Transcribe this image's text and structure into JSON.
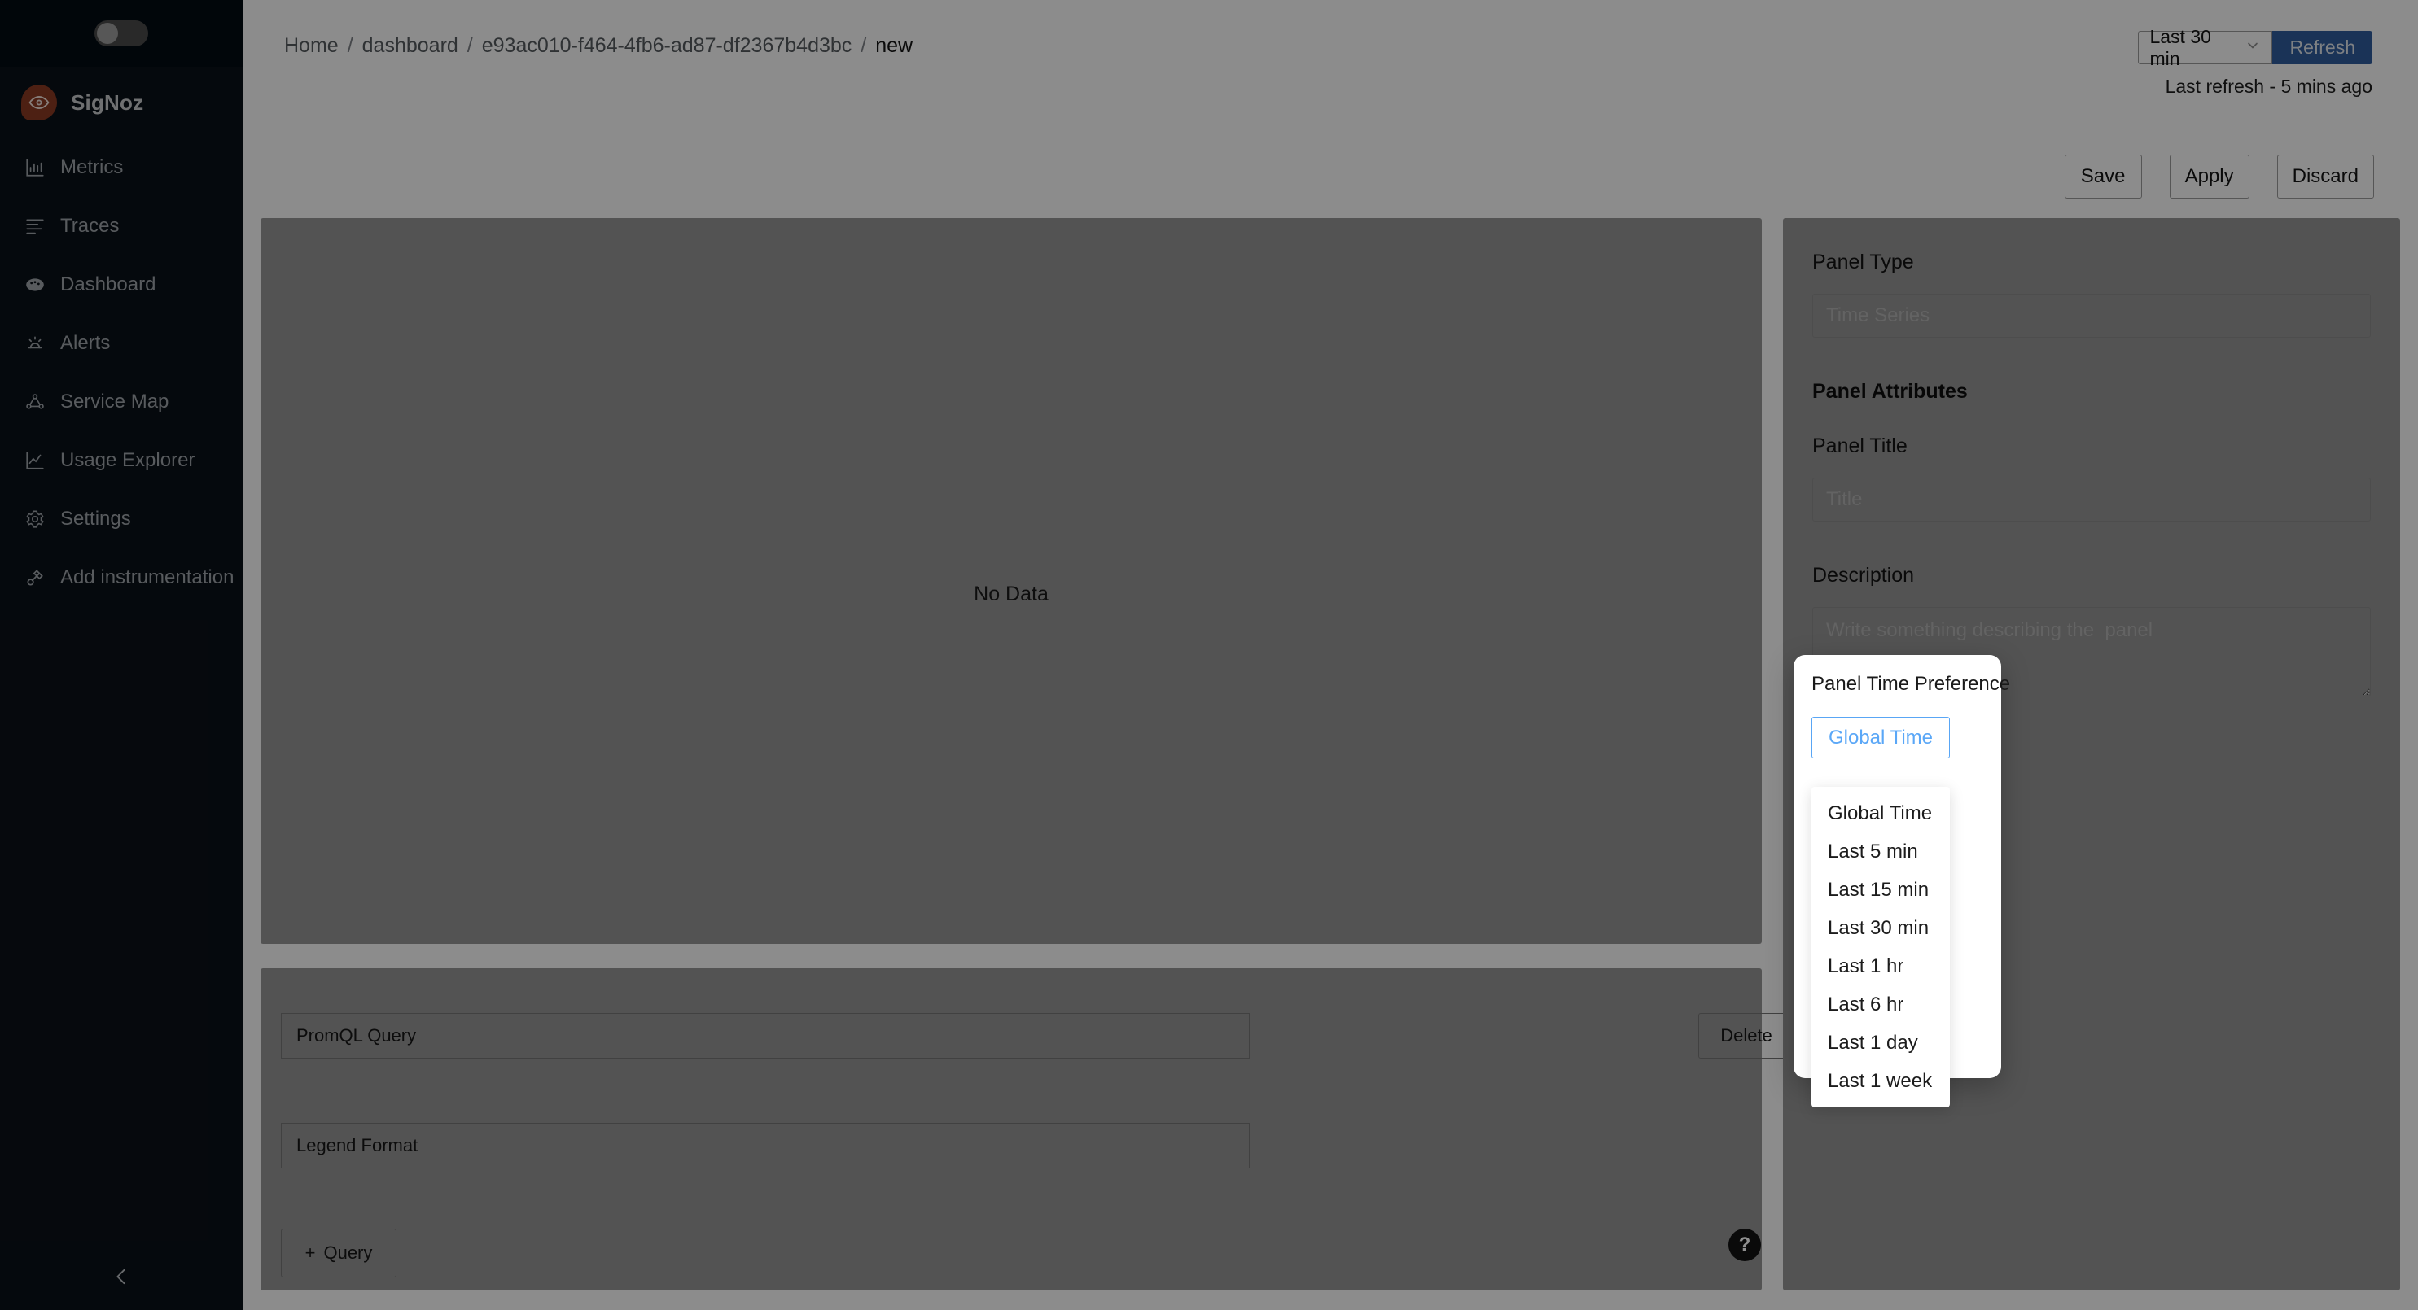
{
  "sidebar": {
    "brand": "SigNoz",
    "items": [
      {
        "label": "Metrics",
        "icon": "bar-chart-icon"
      },
      {
        "label": "Traces",
        "icon": "align-left-icon"
      },
      {
        "label": "Dashboard",
        "icon": "dashboard-icon"
      },
      {
        "label": "Alerts",
        "icon": "alert-bell-icon"
      },
      {
        "label": "Service Map",
        "icon": "service-map-icon"
      },
      {
        "label": "Usage Explorer",
        "icon": "line-chart-icon"
      },
      {
        "label": "Settings",
        "icon": "gear-icon"
      },
      {
        "label": "Add instrumentation",
        "icon": "plug-icon"
      }
    ],
    "theme_toggle": "dark-mode-toggle",
    "collapse_icon": "chevron-left-icon"
  },
  "topbar": {
    "breadcrumb": [
      {
        "label": "Home",
        "current": false
      },
      {
        "label": "dashboard",
        "current": false
      },
      {
        "label": "e93ac010-f464-4fb6-ad87-df2367b4d3bc",
        "current": false
      },
      {
        "label": "new",
        "current": true
      }
    ],
    "separator": "/",
    "time_range": "Last 30 min",
    "refresh_label": "Refresh",
    "last_refresh": "Last refresh - 5 mins ago",
    "accent_blue": "#2f5b9c"
  },
  "actions": {
    "save": "Save",
    "apply": "Apply",
    "discard": "Discard"
  },
  "chart_panel": {
    "empty_text": "No Data"
  },
  "right_panel": {
    "panel_type_label": "Panel Type",
    "panel_type_placeholder": "Time Series",
    "panel_attributes_heading": "Panel Attributes",
    "panel_title_label": "Panel Title",
    "panel_title_placeholder": "Title",
    "description_label": "Description",
    "description_placeholder": "Write something describing the  panel"
  },
  "time_preference_popup": {
    "title": "Panel Time Preference",
    "selected": "Global Time",
    "selected_color": "#5aa7f7",
    "options": [
      "Global Time",
      "Last 5 min",
      "Last 15 min",
      "Last 30 min",
      "Last 1 hr",
      "Last 6 hr",
      "Last 1 day",
      "Last 1 week"
    ]
  },
  "query_section": {
    "promql_label": "PromQL Query",
    "promql_value": "",
    "legend_label": "Legend Format",
    "legend_value": "",
    "delete_label": "Delete",
    "help_glyph": "?",
    "add_query_label": "Query",
    "add_query_plus": "+"
  },
  "chat_widget": {
    "icon": "chat-bubbles-icon",
    "color": "#3b679f"
  }
}
